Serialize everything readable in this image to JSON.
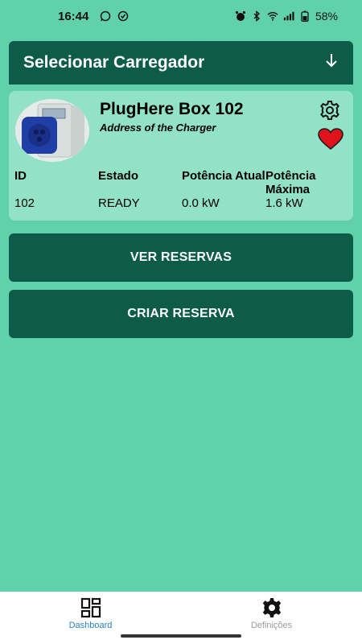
{
  "status_bar": {
    "time": "16:44",
    "battery": "58%",
    "icons": [
      "whatsapp-icon",
      "check-circle-icon",
      "alarm-icon",
      "bluetooth-icon",
      "wifi-icon",
      "signal-icon",
      "battery-icon"
    ]
  },
  "selector": {
    "label": "Selecionar Carregador",
    "icon": "arrow-down-icon"
  },
  "charger": {
    "name": "PlugHere Box 102",
    "address": "Address of the Charger",
    "favorite_color": "#e0121b",
    "columns": [
      {
        "header": "ID",
        "value": "102"
      },
      {
        "header": "Estado",
        "value": "READY"
      },
      {
        "header": "Potência Atual",
        "value": "0.0 kW"
      },
      {
        "header": "Potência Máxima",
        "value": "1.6 kW"
      }
    ]
  },
  "actions": {
    "view_reservations": "VER RESERVAS",
    "create_reservation": "CRIAR RESERVA"
  },
  "bottom_nav": {
    "items": [
      {
        "label": "Dashboard",
        "icon": "dashboard-icon",
        "active": true
      },
      {
        "label": "Definições",
        "icon": "settings-icon",
        "active": false
      }
    ]
  },
  "colors": {
    "background": "#61d1ac",
    "primary": "#0d5c4a",
    "card": "#92e2c7",
    "active_nav": "#2a7fc1"
  }
}
